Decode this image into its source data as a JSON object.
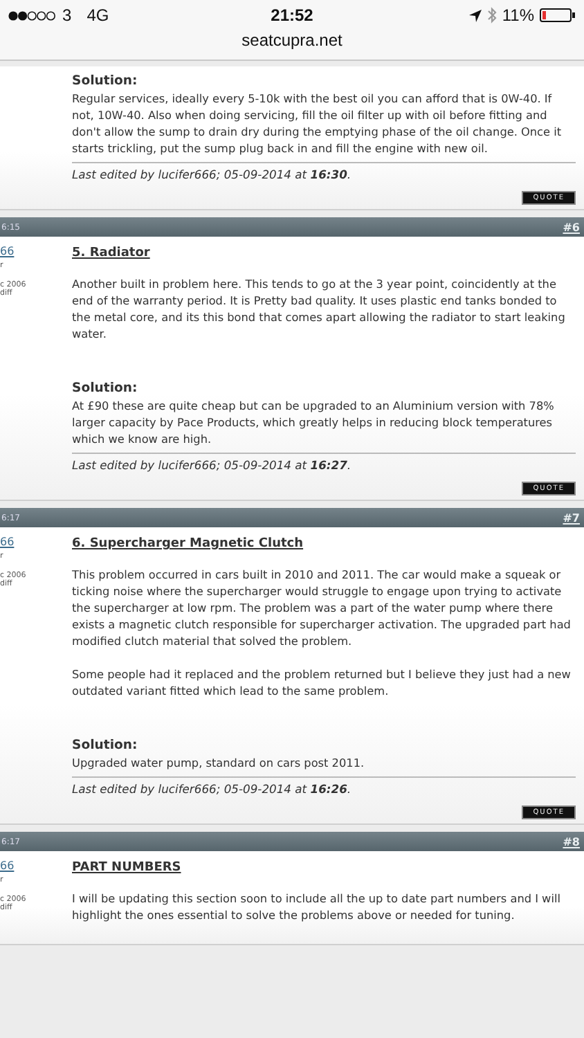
{
  "status_bar": {
    "carrier": "3",
    "network": "4G",
    "time": "21:52",
    "battery": "11%"
  },
  "address_bar": {
    "url": "seatcupra.net"
  },
  "posts": [
    {
      "blocks": [
        {
          "kind": "solution",
          "label": "Solution:",
          "text": "Regular services, ideally every 5-10k with the best oil you can afford that is 0W-40. If\nnot, 10W-40. Also when doing servicing, fill the oil filter up with oil before fitting and\ndon't allow the sump to drain dry during the emptying phase of the oil change. Once it\nstarts trickling, put the sump plug back in and fill the engine with new oil."
        }
      ],
      "edited": "Last edited by lucifer666; 05-09-2014 at **16:30**.",
      "quote": "QUOTE"
    },
    {
      "time": "6:15",
      "number": "#6",
      "user": {
        "name": "66",
        "rank": "r",
        "joined": "c 2006",
        "location": "diff"
      },
      "blocks": [
        {
          "kind": "title",
          "text": "5. Radiator"
        },
        {
          "kind": "paragraph",
          "text": "Another built in problem here. This tends to go at the 3 year point, coincidently at the end of the warranty period. It is Pretty bad quality. It uses plastic end tanks bonded to the metal core, and its this bond that comes apart allowing the radiator to start leaking water."
        },
        {
          "kind": "solution",
          "label": "Solution:",
          "text": "At £90 these are quite cheap but can be upgraded to an Aluminium version with 78% larger capacity by Pace Products, which greatly helps in reducing block temperatures which we know are high."
        }
      ],
      "edited": "Last edited by lucifer666; 05-09-2014 at **16:27**.",
      "quote": "QUOTE"
    },
    {
      "time": "6:17",
      "number": "#7",
      "user": {
        "name": "66",
        "rank": "r",
        "joined": "c 2006",
        "location": "diff"
      },
      "blocks": [
        {
          "kind": "title",
          "text": "6. Supercharger Magnetic Clutch"
        },
        {
          "kind": "paragraph",
          "text": "This problem occurred in cars built in 2010 and 2011. The car would make a squeak or ticking noise where the supercharger would struggle to engage upon trying to activate the supercharger at low rpm. The problem was a part of the water pump where there exists a magnetic clutch responsible for supercharger activation. The upgraded part had modified clutch material that solved the problem."
        },
        {
          "kind": "paragraph",
          "text": "Some people had it replaced and the problem returned but I believe they just had a new outdated variant fitted which lead to the same problem."
        },
        {
          "kind": "solution",
          "label": "Solution:",
          "text": "Upgraded water pump, standard on cars post 2011."
        }
      ],
      "edited": "Last edited by lucifer666; 05-09-2014 at **16:26**.",
      "quote": "QUOTE"
    },
    {
      "time": "6:17",
      "number": "#8",
      "user": {
        "name": "66",
        "rank": "r",
        "joined": "c 2006",
        "location": "diff"
      },
      "blocks": [
        {
          "kind": "title",
          "text": "PART NUMBERS"
        },
        {
          "kind": "paragraph",
          "text": "I will be updating this section soon to include all the up to date part numbers and I will highlight the ones essential to solve the problems above or needed for tuning."
        }
      ]
    }
  ]
}
